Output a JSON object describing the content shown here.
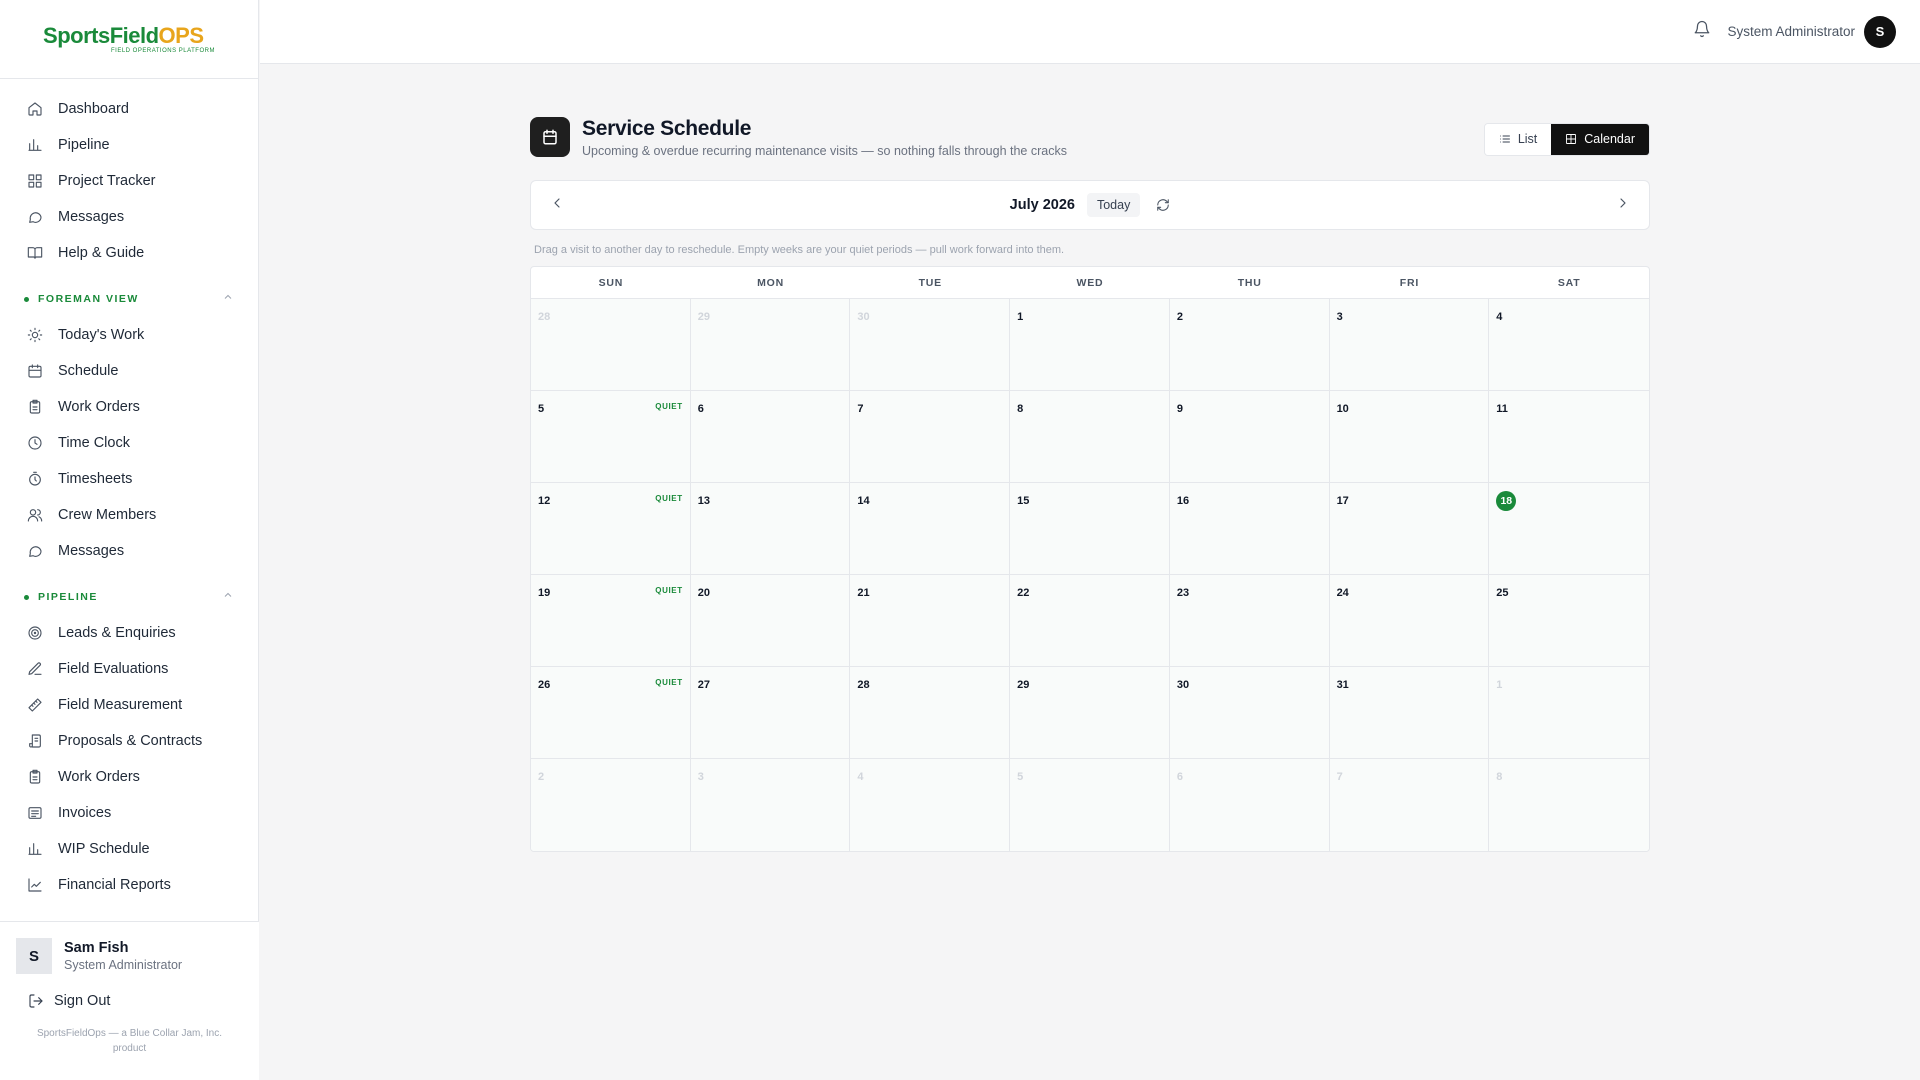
{
  "brand": {
    "name_part1": "SportsField",
    "name_part2": "OPS",
    "tagline": "FIELD OPERATIONS PLATFORM"
  },
  "sidebar": {
    "main_items": [
      {
        "label": "Dashboard",
        "icon": "home-icon"
      },
      {
        "label": "Pipeline",
        "icon": "bar-chart-icon"
      },
      {
        "label": "Project Tracker",
        "icon": "grid-icon"
      },
      {
        "label": "Messages",
        "icon": "message-icon"
      },
      {
        "label": "Help & Guide",
        "icon": "book-icon"
      }
    ],
    "sections": [
      {
        "title": "FOREMAN VIEW",
        "items": [
          {
            "label": "Today's Work",
            "icon": "sun-icon"
          },
          {
            "label": "Schedule",
            "icon": "calendar-icon"
          },
          {
            "label": "Work Orders",
            "icon": "clipboard-icon"
          },
          {
            "label": "Time Clock",
            "icon": "clock-icon"
          },
          {
            "label": "Timesheets",
            "icon": "stopwatch-icon"
          },
          {
            "label": "Crew Members",
            "icon": "users-icon"
          },
          {
            "label": "Messages",
            "icon": "message-icon"
          }
        ]
      },
      {
        "title": "PIPELINE",
        "items": [
          {
            "label": "Leads & Enquiries",
            "icon": "target-icon"
          },
          {
            "label": "Field Evaluations",
            "icon": "edit-icon"
          },
          {
            "label": "Field Measurement",
            "icon": "ruler-icon"
          },
          {
            "label": "Proposals & Contracts",
            "icon": "scroll-icon"
          },
          {
            "label": "Work Orders",
            "icon": "clipboard-icon"
          },
          {
            "label": "Invoices",
            "icon": "invoice-icon"
          },
          {
            "label": "WIP Schedule",
            "icon": "bar-chart-icon"
          },
          {
            "label": "Financial Reports",
            "icon": "trend-icon"
          }
        ]
      }
    ],
    "user": {
      "initial": "S",
      "name": "Sam Fish",
      "role": "System Administrator"
    },
    "sign_out": "Sign Out",
    "credit": "SportsFieldOps — a Blue Collar Jam, Inc. product"
  },
  "header": {
    "user_label": "System Administrator",
    "avatar_initial": "S"
  },
  "page": {
    "title": "Service Schedule",
    "subtitle": "Upcoming & overdue recurring maintenance visits — so nothing falls through the cracks",
    "view_list": "List",
    "view_calendar": "Calendar",
    "active_view": "Calendar"
  },
  "calendar": {
    "month_label": "July 2026",
    "today_button": "Today",
    "hint": "Drag a visit to another day to reschedule. Empty weeks are your quiet periods — pull work forward into them.",
    "weekdays": [
      "SUN",
      "MON",
      "TUE",
      "WED",
      "THU",
      "FRI",
      "SAT"
    ],
    "quiet_label": "QUIET",
    "today": 18,
    "weeks": [
      [
        {
          "d": "28",
          "o": true
        },
        {
          "d": "29",
          "o": true
        },
        {
          "d": "30",
          "o": true
        },
        {
          "d": "1"
        },
        {
          "d": "2"
        },
        {
          "d": "3"
        },
        {
          "d": "4"
        }
      ],
      [
        {
          "d": "5",
          "q": true
        },
        {
          "d": "6"
        },
        {
          "d": "7"
        },
        {
          "d": "8"
        },
        {
          "d": "9"
        },
        {
          "d": "10"
        },
        {
          "d": "11"
        }
      ],
      [
        {
          "d": "12",
          "q": true
        },
        {
          "d": "13"
        },
        {
          "d": "14"
        },
        {
          "d": "15"
        },
        {
          "d": "16"
        },
        {
          "d": "17"
        },
        {
          "d": "18",
          "t": true
        }
      ],
      [
        {
          "d": "19",
          "q": true
        },
        {
          "d": "20"
        },
        {
          "d": "21"
        },
        {
          "d": "22"
        },
        {
          "d": "23"
        },
        {
          "d": "24"
        },
        {
          "d": "25"
        }
      ],
      [
        {
          "d": "26",
          "q": true
        },
        {
          "d": "27"
        },
        {
          "d": "28"
        },
        {
          "d": "29"
        },
        {
          "d": "30"
        },
        {
          "d": "31"
        },
        {
          "d": "1",
          "o": true
        }
      ],
      [
        {
          "d": "2",
          "o": true
        },
        {
          "d": "3",
          "o": true
        },
        {
          "d": "4",
          "o": true
        },
        {
          "d": "5",
          "o": true
        },
        {
          "d": "6",
          "o": true
        },
        {
          "d": "7",
          "o": true
        },
        {
          "d": "8",
          "o": true
        }
      ]
    ]
  },
  "colors": {
    "brand_green": "#1a8a3a",
    "brand_orange": "#e8a51c",
    "active_toggle": "#111111"
  }
}
